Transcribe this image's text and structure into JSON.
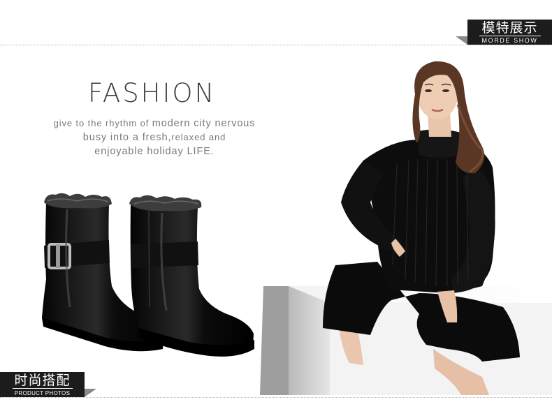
{
  "header": {
    "badge_cn": "模特展示",
    "badge_en": "MORDE SHOW"
  },
  "hero": {
    "title": "FASHION",
    "tagline": [
      {
        "small": "give to the rhythm of ",
        "big": "modern city nervous"
      },
      {
        "small_a": "busy into a fresh,",
        "small_b": "relaxed and"
      },
      {
        "text": "enjoyable holiday LIFE."
      }
    ]
  },
  "footer": {
    "badge_cn": "时尚搭配",
    "badge_en": "PRODUCT PHOTOS"
  },
  "images": {
    "product": "black-leather-fur-lined-ankle-boots",
    "model": "model-in-black-turtleneck-and-culottes"
  },
  "colors": {
    "badge_bg": "#1c1c1c",
    "text_gray": "#7a7a7a",
    "title_gray": "#3a3a3a"
  }
}
